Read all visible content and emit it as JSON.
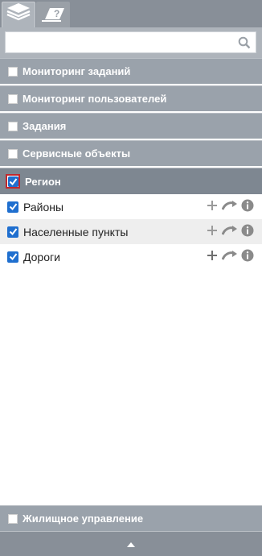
{
  "search": {
    "placeholder": ""
  },
  "groups": [
    {
      "label": "Мониторинг заданий"
    },
    {
      "label": "Мониторинг пользователей"
    },
    {
      "label": "Задания"
    },
    {
      "label": "Сервисные объекты"
    },
    {
      "label": "Регион"
    }
  ],
  "layers": [
    {
      "label": "Районы"
    },
    {
      "label": "Населенные пункты"
    },
    {
      "label": "Дороги"
    }
  ],
  "footer_group": {
    "label": "Жилищное управление"
  },
  "colors": {
    "accent": "#1f6fcf",
    "highlight_border": "#c0282d",
    "header": "#9aa2ab"
  },
  "icons": [
    "layers-icon",
    "help-map-icon",
    "search-icon",
    "plus-icon",
    "zoom-to-icon",
    "info-icon",
    "collapse-up-icon"
  ]
}
